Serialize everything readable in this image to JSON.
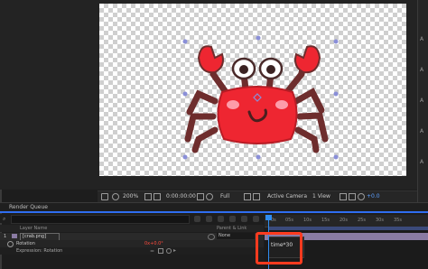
{
  "viewer": {
    "zoom": "200%",
    "timecode": "0:00:00:00",
    "resolution": "Full",
    "camera": "Active Camera",
    "views": "1 View",
    "exposure": "+0.0"
  },
  "right_strip": [
    "A",
    "A",
    "A",
    "A",
    "A"
  ],
  "timeline": {
    "panel_title": "Render Queue",
    "search_placeholder": "",
    "columns": {
      "layer_name": "Layer Name",
      "parent": "Parent & Link"
    },
    "layer": {
      "index": "1",
      "name": "[crab.png]",
      "parent": "None"
    },
    "property": {
      "name": "Rotation",
      "value": "0x+0.0°"
    },
    "expression_label": "Expression: Rotation",
    "ruler_ticks": [
      "0s",
      "05s",
      "10s",
      "15s",
      "20s",
      "25s",
      "30s",
      "35s"
    ],
    "expression_text": "time*30",
    "colors": {
      "highlight": "#ff3b1f",
      "playhead": "#2f8cf0",
      "layer_bar": "#8a7ba3"
    }
  },
  "icons": [
    "search-icon",
    "gear-icon",
    "camera-icon",
    "stopwatch-icon",
    "graph-icon",
    "eye-icon"
  ]
}
